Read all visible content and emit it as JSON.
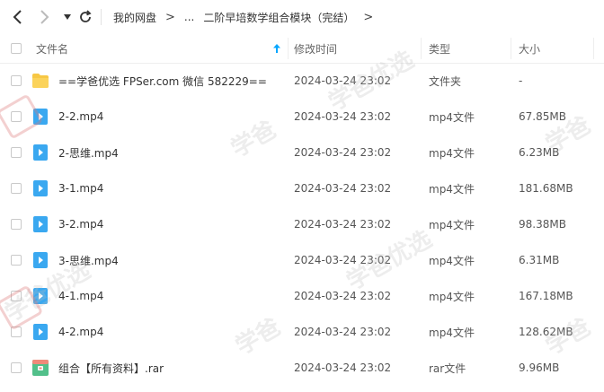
{
  "breadcrumb": {
    "root": "我的网盘",
    "ellipsis": "...",
    "current": "二阶早培数学组合模块（完结）"
  },
  "columns": {
    "name": "文件名",
    "modified": "修改时间",
    "type": "类型",
    "size": "大小"
  },
  "files": [
    {
      "name": "==学爸优选 FPSer.com 微信 582229==",
      "modified": "2024-03-24 23:02",
      "type": "文件夹",
      "size": "-",
      "icon": "folder-icon"
    },
    {
      "name": "2-2.mp4",
      "modified": "2024-03-24 23:02",
      "type": "mp4文件",
      "size": "67.85MB",
      "icon": "video-file-icon"
    },
    {
      "name": "2-思维.mp4",
      "modified": "2024-03-24 23:02",
      "type": "mp4文件",
      "size": "6.23MB",
      "icon": "video-file-icon"
    },
    {
      "name": "3-1.mp4",
      "modified": "2024-03-24 23:02",
      "type": "mp4文件",
      "size": "181.68MB",
      "icon": "video-file-icon"
    },
    {
      "name": "3-2.mp4",
      "modified": "2024-03-24 23:02",
      "type": "mp4文件",
      "size": "98.38MB",
      "icon": "video-file-icon"
    },
    {
      "name": "3-思维.mp4",
      "modified": "2024-03-24 23:02",
      "type": "mp4文件",
      "size": "6.31MB",
      "icon": "video-file-icon"
    },
    {
      "name": "4-1.mp4",
      "modified": "2024-03-24 23:02",
      "type": "mp4文件",
      "size": "167.18MB",
      "icon": "video-file-icon"
    },
    {
      "name": "4-2.mp4",
      "modified": "2024-03-24 23:02",
      "type": "mp4文件",
      "size": "128.62MB",
      "icon": "video-file-icon"
    },
    {
      "name": "组合【所有资料】.rar",
      "modified": "2024-03-24 23:02",
      "type": "rar文件",
      "size": "9.96MB",
      "icon": "archive-file-icon"
    }
  ],
  "watermark": {
    "text": "学爸优选",
    "short": "学爸",
    "badge": "优"
  },
  "colors": {
    "accent": "#06a7ff",
    "folder": "#f7c744",
    "video": "#3aa8f0",
    "archive": "#52c08a"
  }
}
